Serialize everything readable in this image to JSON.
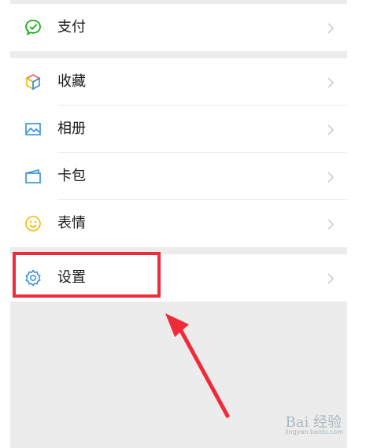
{
  "menu": {
    "pay": {
      "label": "支付",
      "icon": "wechat-pay-icon",
      "color": "#1aad19"
    },
    "favorites": {
      "label": "收藏",
      "icon": "cube-icon"
    },
    "album": {
      "label": "相册",
      "icon": "image-icon",
      "color": "#2f8de0"
    },
    "cards": {
      "label": "卡包",
      "icon": "card-wallet-icon",
      "color": "#2f8de0"
    },
    "stickers": {
      "label": "表情",
      "icon": "smiley-icon",
      "color": "#f5b800"
    },
    "settings": {
      "label": "设置",
      "icon": "gear-icon",
      "color": "#2f8de0"
    }
  },
  "annotation": {
    "highlight_color": "#ef2b3a"
  },
  "watermark": {
    "brand": "Bai",
    "suffix": "经验",
    "url": "jingyan.baidu.com"
  }
}
